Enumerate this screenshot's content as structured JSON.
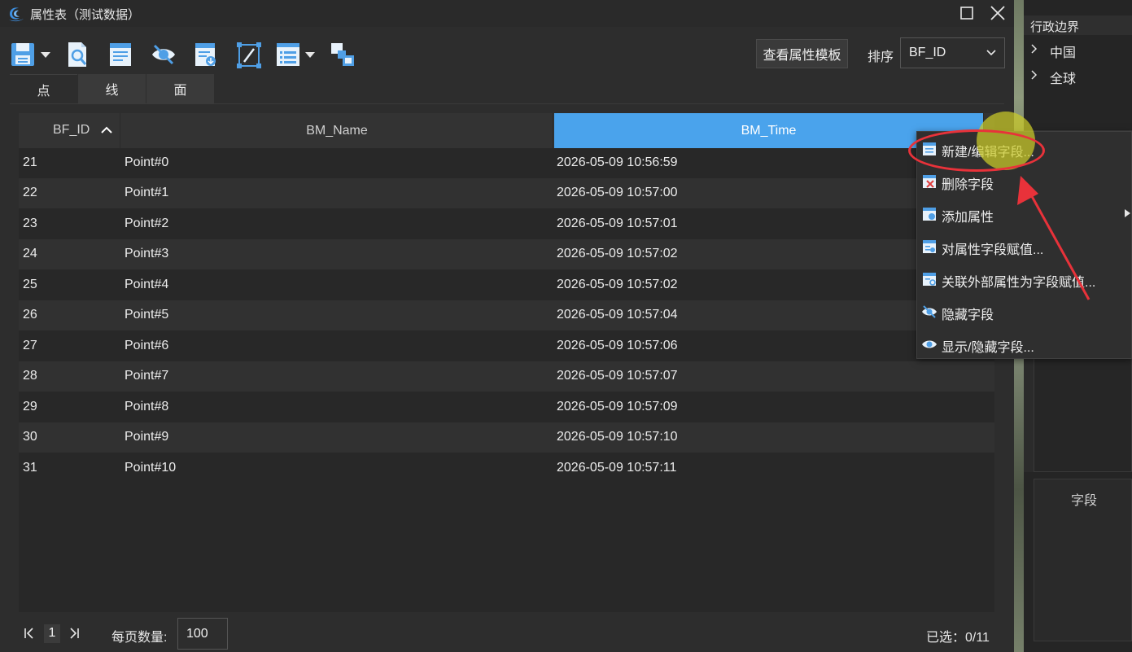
{
  "window": {
    "title": "属性表（测试数据）"
  },
  "toolbar": {
    "icons": [
      "save-icon",
      "query-icon",
      "attribute-table-icon",
      "visibility-icon",
      "export-icon",
      "edit-field-icon",
      "list-options-icon",
      "relation-icon"
    ],
    "template_button": "查看属性模板",
    "sort_label": "排序",
    "sort_value": "BF_ID"
  },
  "tabs": [
    {
      "label": "点",
      "active": true
    },
    {
      "label": "线",
      "active": false
    },
    {
      "label": "面",
      "active": false
    }
  ],
  "table": {
    "columns": [
      "BF_ID",
      "BM_Name",
      "BM_Time"
    ],
    "selected_column": "BM_Time",
    "sort_column": "BF_ID",
    "sort_direction": "ascending",
    "rows": [
      [
        "21",
        "Point#0",
        "2026-05-09 10:56:59"
      ],
      [
        "22",
        "Point#1",
        "2026-05-09 10:57:00"
      ],
      [
        "23",
        "Point#2",
        "2026-05-09 10:57:01"
      ],
      [
        "24",
        "Point#3",
        "2026-05-09 10:57:02"
      ],
      [
        "25",
        "Point#4",
        "2026-05-09 10:57:02"
      ],
      [
        "26",
        "Point#5",
        "2026-05-09 10:57:04"
      ],
      [
        "27",
        "Point#6",
        "2026-05-09 10:57:06"
      ],
      [
        "28",
        "Point#7",
        "2026-05-09 10:57:07"
      ],
      [
        "29",
        "Point#8",
        "2026-05-09 10:57:09"
      ],
      [
        "30",
        "Point#9",
        "2026-05-09 10:57:10"
      ],
      [
        "31",
        "Point#10",
        "2026-05-09 10:57:11"
      ]
    ]
  },
  "footer": {
    "page": "1",
    "per_page_label": "每页数量:",
    "per_page_value": "100",
    "selected_text": "已选：0/11"
  },
  "context_menu": {
    "items": [
      {
        "label": "新建/编辑字段...",
        "icon": "field-edit-icon",
        "submenu": false
      },
      {
        "label": "删除字段",
        "icon": "field-delete-icon",
        "submenu": false
      },
      {
        "label": "添加属性",
        "icon": "add-attribute-icon",
        "submenu": true
      },
      {
        "label": "对属性字段赋值...",
        "icon": "assign-value-icon",
        "submenu": false
      },
      {
        "label": "关联外部属性为字段赋值...",
        "icon": "link-external-icon",
        "submenu": false
      },
      {
        "label": "隐藏字段",
        "icon": "hide-field-icon",
        "submenu": false
      },
      {
        "label": "显示/隐藏字段...",
        "icon": "show-hide-field-icon",
        "submenu": false
      }
    ]
  },
  "dock": {
    "title": "行政边界",
    "tree": [
      "中国",
      "全球"
    ],
    "field_label": "字段"
  },
  "colors": {
    "accent": "#4aa3ec",
    "annotation": "#e8323a",
    "cursor_highlight": "#cccc28"
  }
}
